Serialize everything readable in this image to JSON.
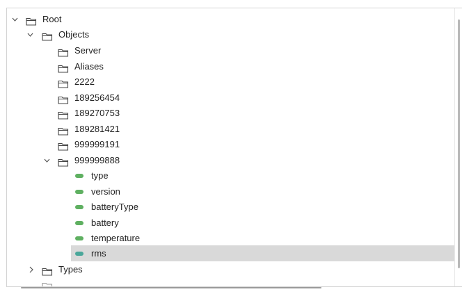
{
  "tree": {
    "root": {
      "label": "Root",
      "expanded": true
    },
    "objects": {
      "label": "Objects",
      "expanded": true
    },
    "objects_children": [
      {
        "label": "Server"
      },
      {
        "label": "Aliases"
      },
      {
        "label": "2222"
      },
      {
        "label": "189256454"
      },
      {
        "label": "189270753"
      },
      {
        "label": "189281421"
      },
      {
        "label": "999999191"
      }
    ],
    "expanded_node": {
      "label": "999999888",
      "expanded": true
    },
    "variables": [
      {
        "label": "type"
      },
      {
        "label": "version"
      },
      {
        "label": "batteryType"
      },
      {
        "label": "battery"
      },
      {
        "label": "temperature"
      },
      {
        "label": "rms",
        "selected": true
      }
    ],
    "types": {
      "label": "Types",
      "expanded": false
    }
  },
  "colors": {
    "leaf_icon": "#5fb061",
    "selected_leaf_icon": "#4aa79a",
    "selection_background": "#d9d9d9"
  },
  "icons": {
    "folder": "folder-icon",
    "variable": "variable-icon",
    "expand": "chevron-down-icon",
    "collapse": "chevron-right-icon"
  }
}
